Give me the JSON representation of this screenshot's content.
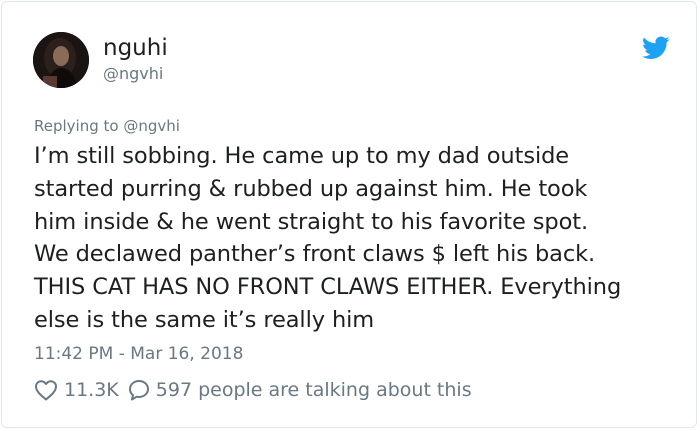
{
  "tweet": {
    "author_name": "nguhi",
    "author_handle": "@ngvhi",
    "avatar_icon": "user-avatar",
    "brand_icon": "twitter-bird-icon",
    "brand_color": "#1da1f2",
    "reply_prefix": "Replying to ",
    "reply_to": "@ngvhi",
    "text": "I’m still sobbing. He came up to my dad outside\nstarted purring & rubbed up against him. He took\nhim inside & he went straight to his favorite spot.\nWe declawed panther’s front claws $ left his back.\nTHIS CAT HAS NO FRONT CLAWS EITHER. Everything\nelse is the same it’s really him",
    "timestamp": "11:42 PM - Mar 16, 2018",
    "likes": "11.3K",
    "conversation": "597 people are talking about this"
  }
}
